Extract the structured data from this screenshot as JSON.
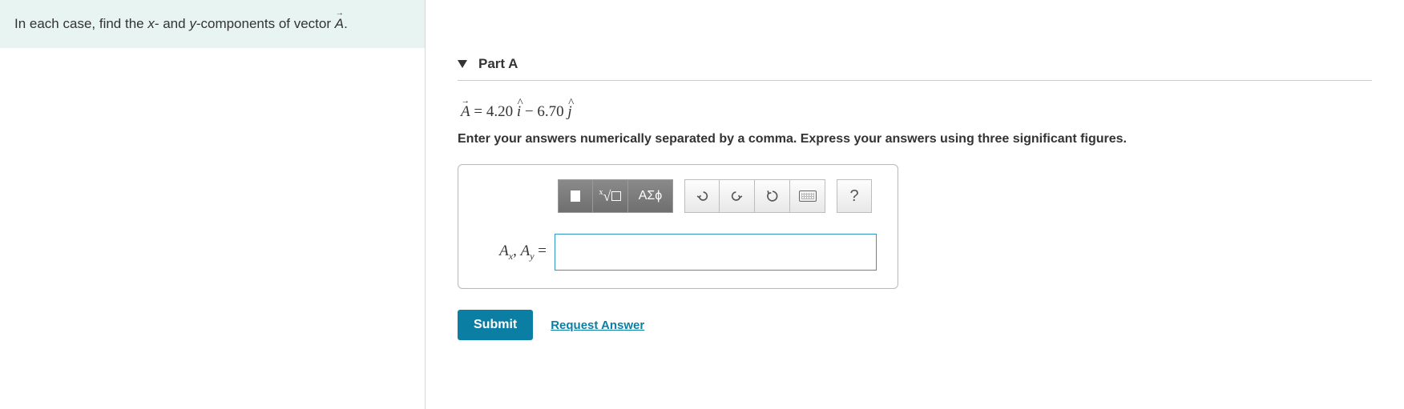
{
  "prompt": {
    "prefix": "In each case, find the ",
    "xvar": "x",
    "mid1": "- and ",
    "yvar": "y",
    "mid2": "-components of vector ",
    "vectorSymbol": "A",
    "suffix": "."
  },
  "part": {
    "label": "Part A"
  },
  "equation": {
    "lhs": "A",
    "eq": " = ",
    "coeff1": "4.20",
    "unit1": "i",
    "minus": " − ",
    "coeff2": "6.70",
    "unit2": "j"
  },
  "instruction": "Enter your answers numerically separated by a comma. Express your answers using three significant figures.",
  "toolbar": {
    "templateBtn": "▭",
    "rootBtn": "√▭",
    "greekBtn": "ΑΣϕ",
    "undo": "↶",
    "redo": "↷",
    "reset": "↺",
    "keyboard": "⌨",
    "help": "?"
  },
  "answerField": {
    "label_A": "A",
    "label_x": "x",
    "label_comma": ", ",
    "label_y": "y",
    "label_eq": " =",
    "value": ""
  },
  "actions": {
    "submit": "Submit",
    "requestAnswer": "Request Answer"
  }
}
